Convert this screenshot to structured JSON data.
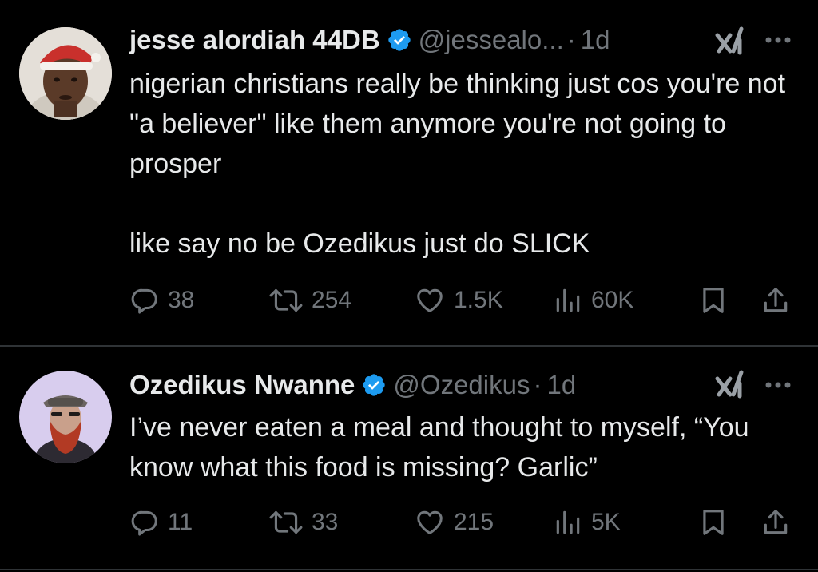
{
  "tweets": [
    {
      "display_name": "jesse alordiah 44DB",
      "handle": "@jessealo...",
      "dot": "·",
      "time": "1d",
      "text_lines": [
        "nigerian christians really be thinking just cos you're not \"a believer\" like them anymore you're not going to prosper",
        "like say no be Ozedikus just do SLICK"
      ],
      "stats": {
        "replies": "38",
        "reposts": "254",
        "likes": "1.5K",
        "views": "60K"
      },
      "verified": true
    },
    {
      "display_name": "Ozedikus Nwanne",
      "handle": "@Ozedikus",
      "dot": "·",
      "time": "1d",
      "text_lines": [
        "I’ve never eaten a meal and thought to myself, “You know what this food is missing? Garlic”"
      ],
      "stats": {
        "replies": "11",
        "reposts": "33",
        "likes": "215",
        "views": "5K"
      },
      "verified": true
    }
  ],
  "icons": {
    "verified": "verified-badge-icon",
    "grok": "grok-icon",
    "more": "more-icon",
    "reply": "reply-icon",
    "repost": "repost-icon",
    "like": "heart-icon",
    "views": "views-icon",
    "bookmark": "bookmark-icon",
    "share": "share-icon"
  },
  "colors": {
    "background": "#000000",
    "text": "#e7e9ea",
    "muted": "#71767b",
    "verified": "#1d9bf0",
    "divider": "#2f3336"
  }
}
